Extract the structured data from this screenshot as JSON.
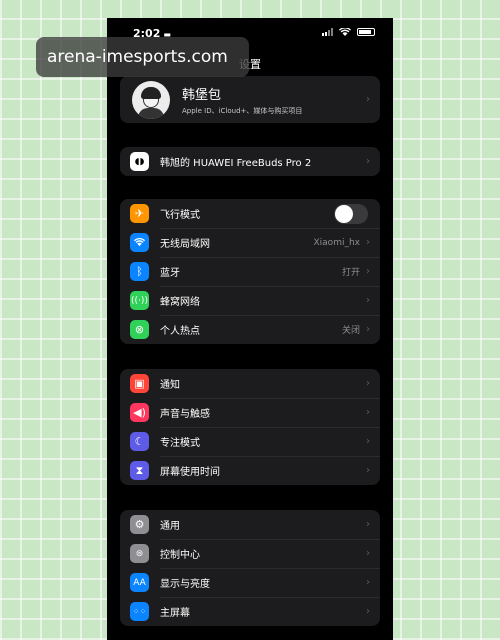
{
  "watermark": "arena-imesports.com",
  "status_bar": {
    "time": "2:02"
  },
  "nav": {
    "title": "设置"
  },
  "profile": {
    "name": "韩堡包",
    "subtitle": "Apple ID、iCloud+、媒体与购买项目"
  },
  "device": {
    "label": "韩旭的 HUAWEI FreeBuds Pro 2"
  },
  "connectivity": [
    {
      "label": "飞行模式",
      "detail": "",
      "icon": "airplane-icon",
      "color": "#ff9500",
      "toggle": true,
      "toggle_on": false
    },
    {
      "label": "无线局域网",
      "detail": "Xiaomi_hx",
      "icon": "wifi-icon",
      "color": "#0a84ff"
    },
    {
      "label": "蓝牙",
      "detail": "打开",
      "icon": "bluetooth-icon",
      "color": "#0a84ff"
    },
    {
      "label": "蜂窝网络",
      "detail": "",
      "icon": "cellular-icon",
      "color": "#30d158"
    },
    {
      "label": "个人热点",
      "detail": "关闭",
      "icon": "hotspot-icon",
      "color": "#30d158"
    }
  ],
  "notifications": [
    {
      "label": "通知",
      "icon": "notification-icon",
      "color": "#ff453a"
    },
    {
      "label": "声音与触感",
      "icon": "sound-icon",
      "color": "#ff375f"
    },
    {
      "label": "专注模式",
      "icon": "focus-moon-icon",
      "color": "#5e5ce6"
    },
    {
      "label": "屏幕使用时间",
      "icon": "hourglass-icon",
      "color": "#5e5ce6"
    }
  ],
  "general": [
    {
      "label": "通用",
      "icon": "gear-icon",
      "color": "#8e8e93"
    },
    {
      "label": "控制中心",
      "icon": "control-center-icon",
      "color": "#8e8e93"
    },
    {
      "label": "显示与亮度",
      "icon": "display-aa-icon",
      "color": "#0a84ff"
    },
    {
      "label": "主屏幕",
      "icon": "home-screen-icon",
      "color": "#0a84ff"
    }
  ]
}
